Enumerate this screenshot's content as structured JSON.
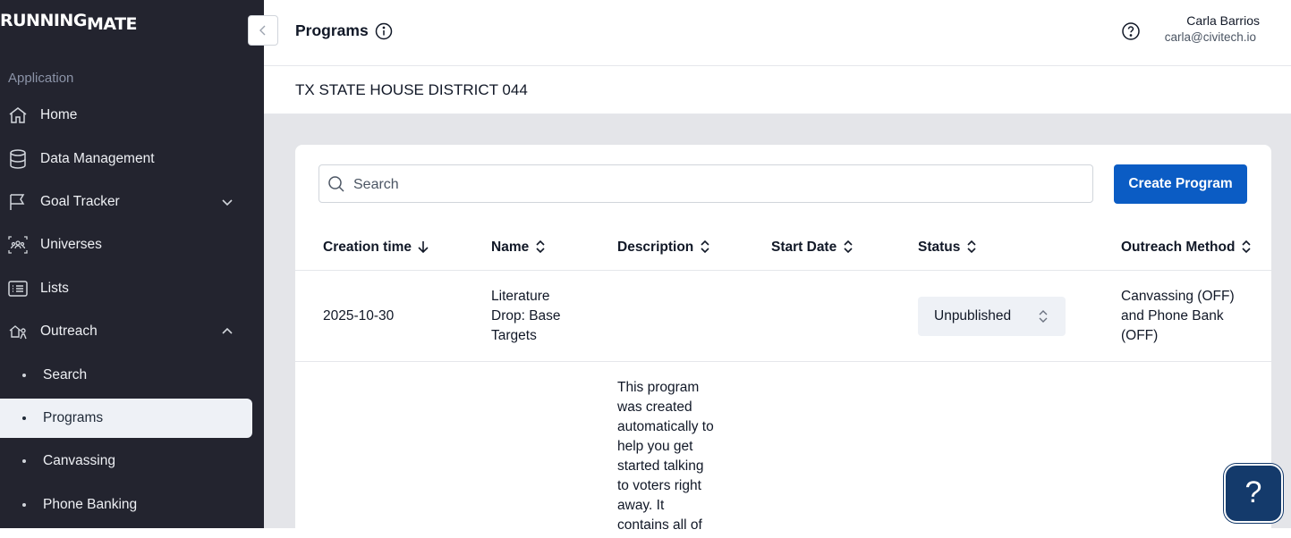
{
  "app": {
    "logo_top": "RUNNING",
    "logo_bottom": "MATE"
  },
  "sidebar": {
    "section_label": "Application",
    "items": [
      {
        "label": "Home",
        "icon": "home-icon"
      },
      {
        "label": "Data Management",
        "icon": "database-icon"
      },
      {
        "label": "Goal Tracker",
        "icon": "flag-icon",
        "expandable": true,
        "expanded": false
      },
      {
        "label": "Universes",
        "icon": "people-group-icon"
      },
      {
        "label": "Lists",
        "icon": "list-icon"
      },
      {
        "label": "Outreach",
        "icon": "outreach-icon",
        "expandable": true,
        "expanded": true
      }
    ],
    "subitems": [
      {
        "label": "Search",
        "active": false
      },
      {
        "label": "Programs",
        "active": true
      },
      {
        "label": "Canvassing",
        "active": false
      },
      {
        "label": "Phone Banking",
        "active": false
      }
    ]
  },
  "header": {
    "title": "Programs",
    "user_name": "Carla Barrios",
    "user_email": "carla@civitech.io"
  },
  "district": "TX STATE HOUSE DISTRICT 044",
  "toolbar": {
    "search_placeholder": "Search",
    "create_label": "Create Program"
  },
  "table": {
    "columns": [
      "Creation time",
      "Name",
      "Description",
      "Start Date",
      "Status",
      "Outreach Method"
    ],
    "rows": [
      {
        "creation_time": "2025-10-30",
        "name": "Literature Drop: Base Targets",
        "description": "",
        "start_date": "",
        "status": "Unpublished",
        "outreach_method": "Canvassing (OFF) and Phone Bank (OFF)"
      },
      {
        "creation_time": "",
        "name": "",
        "description": "This program was created automatically to help you get started talking to voters right away. It contains all of",
        "start_date": "",
        "status": "",
        "outreach_method": ""
      }
    ]
  },
  "help_fab": "?",
  "colors": {
    "sidebar_bg": "#23242f",
    "primary": "#0b5cc4",
    "fab_bg": "#143a6b",
    "content_bg": "#e4e5e9"
  }
}
